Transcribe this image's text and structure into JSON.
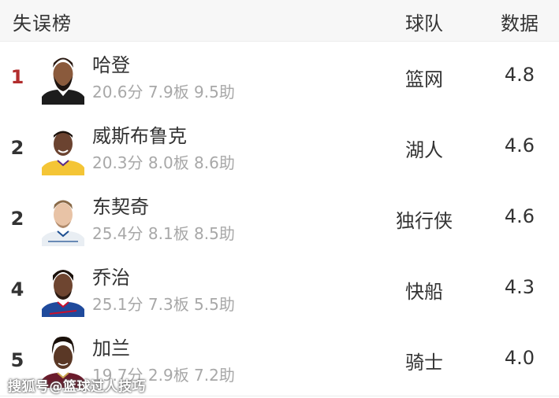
{
  "header": {
    "title": "失误榜",
    "team_label": "球队",
    "value_label": "数据"
  },
  "colors": {
    "rank_first": "#b22d2d",
    "stats_text": "#a8a8a8",
    "divider": "#ececec"
  },
  "rows": [
    {
      "rank": "1",
      "name": "哈登",
      "stats": "20.6分 7.9板 9.5助",
      "team": "篮网",
      "value": "4.8",
      "jersey_color": "#1c1c1c"
    },
    {
      "rank": "2",
      "name": "威斯布鲁克",
      "stats": "20.3分 8.0板 8.6助",
      "team": "湖人",
      "value": "4.6",
      "jersey_color": "#f4c536"
    },
    {
      "rank": "2",
      "name": "东契奇",
      "stats": "25.4分 8.1板 8.5助",
      "team": "独行侠",
      "value": "4.6",
      "jersey_color": "#e9eef3"
    },
    {
      "rank": "4",
      "name": "乔治",
      "stats": "25.1分 7.3板 5.5助",
      "team": "快船",
      "value": "4.3",
      "jersey_color": "#1f4a9c"
    },
    {
      "rank": "5",
      "name": "加兰",
      "stats": "19.7分 2.9板 7.2助",
      "team": "骑士",
      "value": "4.0",
      "jersey_color": "#6b1b2c"
    }
  ],
  "watermark": "搜狐号@篮球过人技巧"
}
